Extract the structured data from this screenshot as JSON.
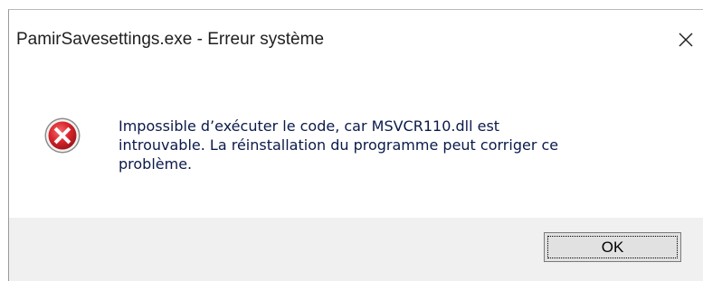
{
  "background_snippet": {
    "text": "",
    "link": ""
  },
  "dialog": {
    "title": "PamirSavesettings.exe - Erreur système",
    "close_label": "×",
    "icon": "error-icon",
    "message_lines": [
      "Impossible d’exécuter le code, car MSVCR110.dll est",
      "introuvable. La réinstallation du programme peut corriger ce",
      "problème."
    ],
    "ok_label": "OK"
  },
  "colors": {
    "error_red": "#d9262c",
    "message_text": "#0b1a4a",
    "footer_bg": "#f0f0f0",
    "button_bg": "#e1e1e1"
  }
}
